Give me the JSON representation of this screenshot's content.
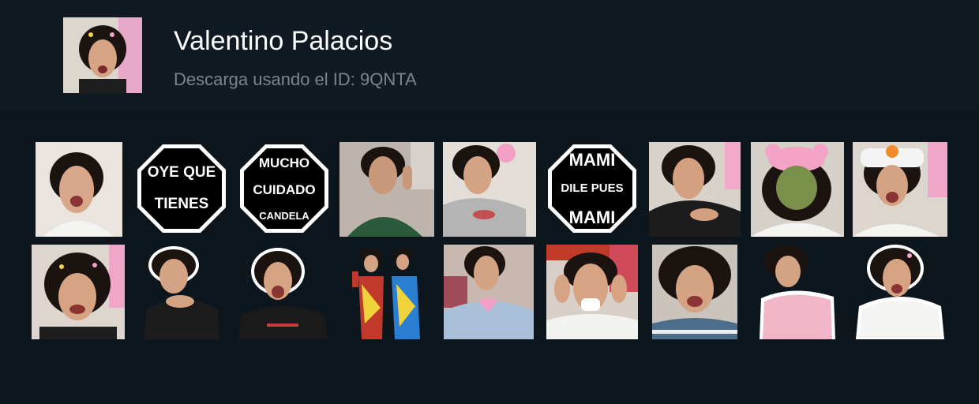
{
  "pack": {
    "title": "Valentino Palacios",
    "subtitle": "Descarga usando el ID: 9QNTA"
  },
  "stop_signs": [
    {
      "line1": "OYE QUE",
      "line2": "TIENES",
      "line3": ""
    },
    {
      "line1": "MUCHO",
      "line2": "CUIDADO",
      "line3": "CANDELA"
    },
    {
      "line1": "MAMI",
      "line2": "DILE PUES",
      "line3": "MAMI"
    }
  ],
  "colors": {
    "header_bg": "#111a22",
    "grid_bg": "#0d161d",
    "title": "#ffffff",
    "subtitle": "#7b848c",
    "stop_sign": "#000000"
  }
}
